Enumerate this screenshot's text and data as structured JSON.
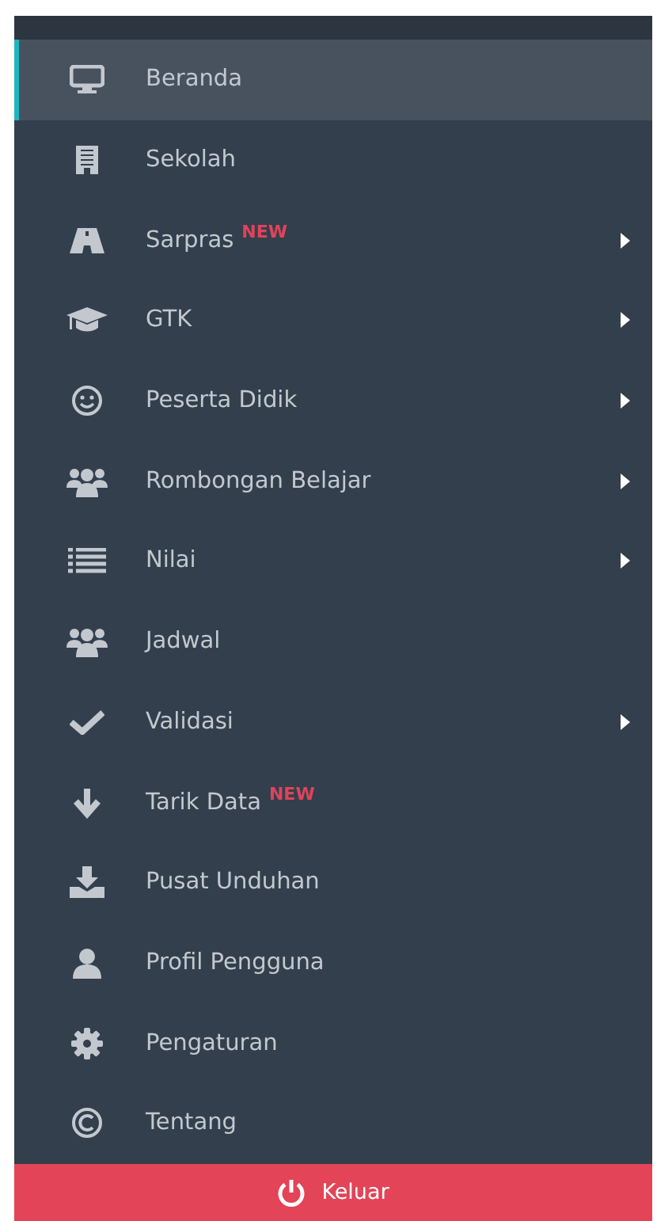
{
  "menu": [
    {
      "label": "Beranda",
      "selected": true,
      "submenu": false
    },
    {
      "label": "Sekolah",
      "selected": false,
      "submenu": false
    },
    {
      "label": "Sarpras",
      "badge": "NEW",
      "selected": false,
      "submenu": true
    },
    {
      "label": "GTK",
      "selected": false,
      "submenu": true
    },
    {
      "label": "Peserta Didik",
      "selected": false,
      "submenu": true
    },
    {
      "label": "Rombongan Belajar",
      "selected": false,
      "submenu": true
    },
    {
      "label": "Nilai",
      "selected": false,
      "submenu": true
    },
    {
      "label": "Jadwal",
      "selected": false,
      "submenu": false
    },
    {
      "label": "Validasi",
      "selected": false,
      "submenu": true
    },
    {
      "label": "Tarik Data",
      "badge": "NEW",
      "selected": false,
      "submenu": false
    },
    {
      "label": "Pusat Unduhan",
      "selected": false,
      "submenu": false
    },
    {
      "label": "Profil Pengguna",
      "selected": false,
      "submenu": false
    },
    {
      "label": "Pengaturan",
      "selected": false,
      "submenu": false
    },
    {
      "label": "Tentang",
      "selected": false,
      "submenu": false
    }
  ],
  "logout": {
    "label": "Keluar"
  }
}
